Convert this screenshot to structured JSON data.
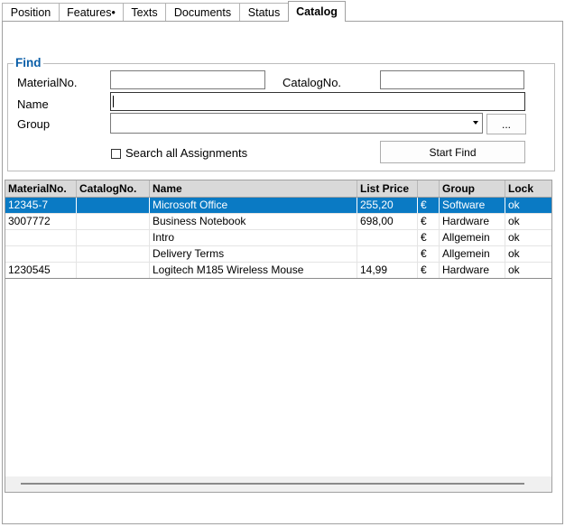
{
  "tabs": [
    {
      "label": "Position",
      "active": false
    },
    {
      "label": "Features•",
      "active": false
    },
    {
      "label": "Texts",
      "active": false
    },
    {
      "label": "Documents",
      "active": false
    },
    {
      "label": "Status",
      "active": false
    },
    {
      "label": "Catalog",
      "active": true
    }
  ],
  "find": {
    "legend": "Find",
    "material_label": "MaterialNo.",
    "material_value": "",
    "catalog_label": "CatalogNo.",
    "catalog_value": "",
    "name_label": "Name",
    "name_value": "",
    "group_label": "Group",
    "group_value": "",
    "browse_label": "...",
    "search_all_label": "Search all Assignments",
    "search_all_checked": false,
    "start_find_label": "Start Find"
  },
  "grid": {
    "columns": [
      "MaterialNo.",
      "CatalogNo.",
      "Name",
      "List Price",
      "",
      "Group",
      "Lock"
    ],
    "rows": [
      {
        "material": "12345-7",
        "catalog": "",
        "name": "Microsoft Office",
        "price": "255,20",
        "currency": "€",
        "group": "Software",
        "lock": "ok",
        "selected": true
      },
      {
        "material": "3007772",
        "catalog": "",
        "name": "Business Notebook",
        "price": "698,00",
        "currency": "€",
        "group": "Hardware",
        "lock": "ok",
        "selected": false
      },
      {
        "material": "",
        "catalog": "",
        "name": "Intro",
        "price": "",
        "currency": "€",
        "group": "Allgemein",
        "lock": "ok",
        "selected": false
      },
      {
        "material": "",
        "catalog": "",
        "name": "Delivery Terms",
        "price": "",
        "currency": "€",
        "group": "Allgemein",
        "lock": "ok",
        "selected": false
      },
      {
        "material": "1230545",
        "catalog": "",
        "name": "Logitech M185 Wireless Mouse",
        "price": "14,99",
        "currency": "€",
        "group": "Hardware",
        "lock": "ok",
        "selected": false
      }
    ]
  },
  "colors": {
    "accent": "#0a5ea8",
    "selection": "#0a7ac4"
  }
}
